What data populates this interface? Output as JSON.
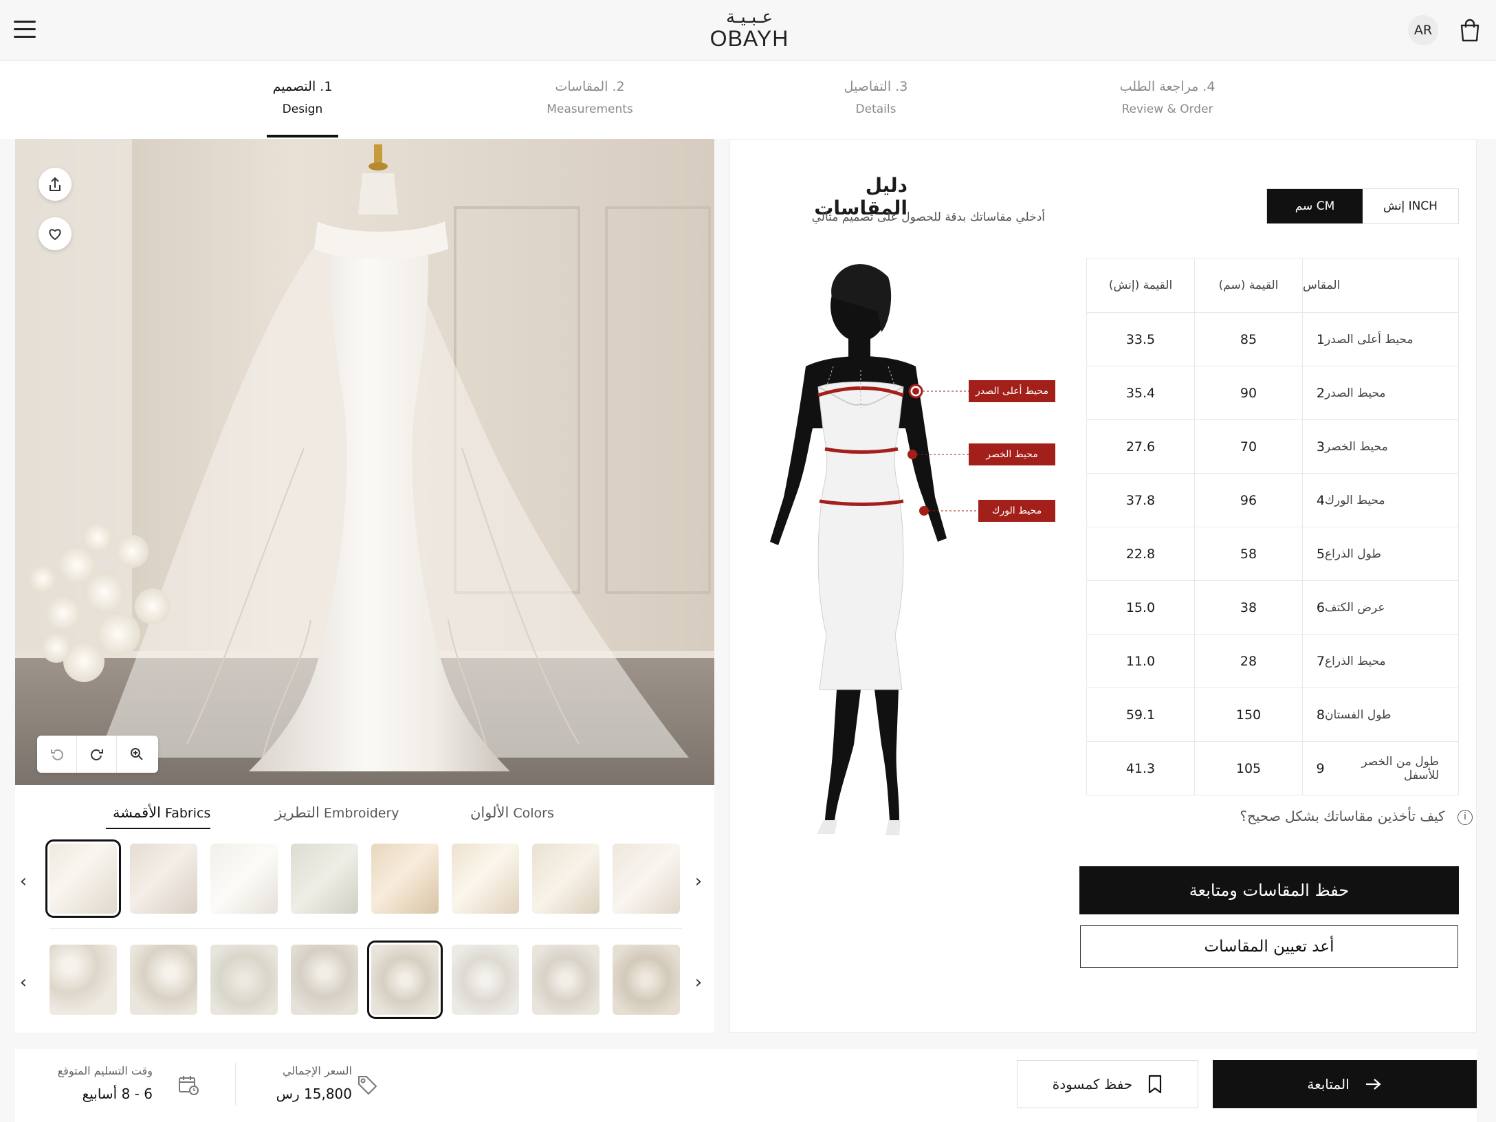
{
  "brand": {
    "logo_ar": "عـبـيـة",
    "logo_en": "OBAYH"
  },
  "header": {
    "lang": "AR"
  },
  "steps": [
    {
      "ar": "1. التصميم",
      "en": "Design"
    },
    {
      "ar": "2. المقاسات",
      "en": "Measurements"
    },
    {
      "ar": "3. التفاصيل",
      "en": "Details"
    },
    {
      "ar": "4. مراجعة الطلب",
      "en": "Review & Order"
    }
  ],
  "tabs": [
    {
      "en": "Fabrics",
      "ar": "الأقمشة"
    },
    {
      "en": "Embroidery",
      "ar": "التطريز"
    },
    {
      "en": "Colors",
      "ar": "الألوان"
    }
  ],
  "swatch_nav": {
    "prev": "‹",
    "next": "›"
  },
  "guide": {
    "title": "دليل المقاسات",
    "subtitle": "أدخلي مقاساتك بدقة للحصول على تصميم مثالي",
    "unit_inch": "إنش INCH",
    "unit_cm": "سم CM",
    "headers": {
      "name": "المقاس",
      "cm": "القيمة (سم)",
      "inch": "القيمة (إنش)"
    },
    "rows": [
      {
        "n": "1",
        "name": "محيط أعلى الصدر",
        "cm": "85",
        "inch": "33.5"
      },
      {
        "n": "2",
        "name": "محيط الصدر",
        "cm": "90",
        "inch": "35.4"
      },
      {
        "n": "3",
        "name": "محيط الخصر",
        "cm": "70",
        "inch": "27.6"
      },
      {
        "n": "4",
        "name": "محيط الورك",
        "cm": "96",
        "inch": "37.8"
      },
      {
        "n": "5",
        "name": "طول الذراع",
        "cm": "58",
        "inch": "22.8"
      },
      {
        "n": "6",
        "name": "عرض الكتف",
        "cm": "38",
        "inch": "15.0"
      },
      {
        "n": "7",
        "name": "محيط الذراع",
        "cm": "28",
        "inch": "11.0"
      },
      {
        "n": "8",
        "name": "طول الفستان",
        "cm": "150",
        "inch": "59.1"
      },
      {
        "n": "9",
        "name": "طول من الخصر للأسفل",
        "cm": "105",
        "inch": "41.3"
      }
    ],
    "figure_labels": {
      "upper_chest": "محيط أعلى الصدر",
      "waist": "محيط الخصر",
      "hip": "محيط الورك"
    },
    "help": "كيف تأخذين مقاساتك بشكل صحيح؟",
    "save_btn": "حفظ المقاسات ومتابعة",
    "reset_btn": "أعد تعيين المقاسات"
  },
  "footer": {
    "delivery_label": "وقت التسليم المتوقع",
    "delivery_value": "6 - 8 أسابيع",
    "price_label": "السعر الإجمالي",
    "price_value": "15,800 رس",
    "draft_btn": "حفظ كمسودة",
    "next_btn": "المتابعة"
  },
  "colors": {
    "accent": "#111111",
    "marker": "#a31f1a"
  }
}
